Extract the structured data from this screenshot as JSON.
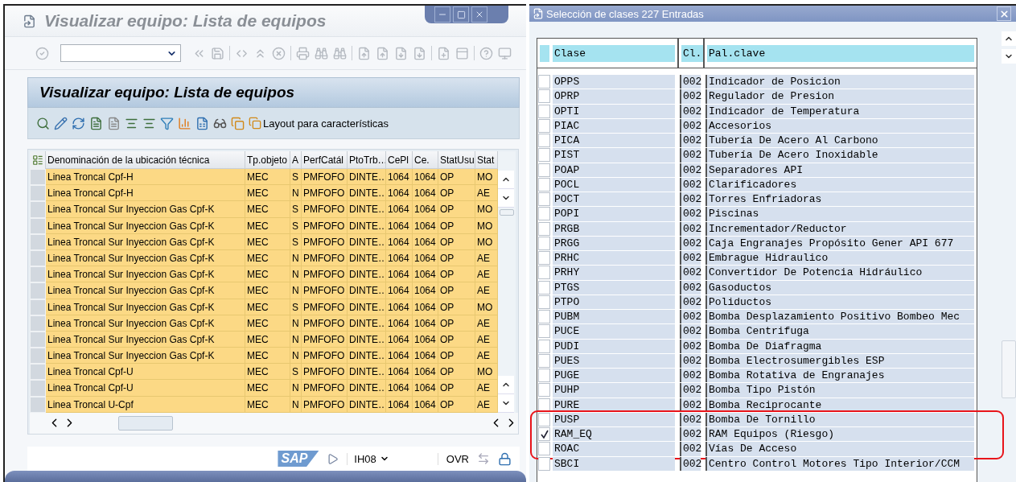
{
  "main_window": {
    "title": "Visualizar equipo: Lista de equipos",
    "header_title": "Visualizar equipo: Lista de equipos",
    "layout_button": "Layout para características"
  },
  "equipment_table": {
    "columns": [
      "Denominación de la ubicación técnica",
      "Tp.objeto",
      "A",
      "PerfCatál",
      "PtoTrb…",
      "CePl",
      "Ce.",
      "StatUsu",
      "Stat"
    ],
    "rows": [
      {
        "cells": [
          "Linea Troncal Cpf-H",
          "MEC",
          "S",
          "PMFOFO",
          "DINTE…",
          "1064",
          "1064",
          "OP",
          "MO"
        ]
      },
      {
        "cells": [
          "Linea Troncal Cpf-H",
          "MEC",
          "N",
          "PMFOFO",
          "DINTE…",
          "1064",
          "1064",
          "OP",
          "AE"
        ]
      },
      {
        "cells": [
          "Linea Troncal Sur Inyeccion Gas Cpf-K",
          "MEC",
          "S",
          "PMFOFO",
          "DINTE…",
          "1064",
          "1064",
          "OP",
          "MO"
        ]
      },
      {
        "cells": [
          "Linea Troncal Sur Inyeccion Gas Cpf-K",
          "MEC",
          "S",
          "PMFOFO",
          "DINTE…",
          "1064",
          "1064",
          "OP",
          "MO"
        ]
      },
      {
        "cells": [
          "Linea Troncal Sur Inyeccion Gas Cpf-K",
          "MEC",
          "S",
          "PMFOFO",
          "DINTE…",
          "1064",
          "1064",
          "OP",
          "MO"
        ]
      },
      {
        "cells": [
          "Linea Troncal Sur Inyeccion Gas Cpf-K",
          "MEC",
          "N",
          "PMFOFO",
          "DINTE…",
          "1064",
          "1064",
          "OP",
          "AE"
        ]
      },
      {
        "cells": [
          "Linea Troncal Sur Inyeccion Gas Cpf-K",
          "MEC",
          "N",
          "PMFOFO",
          "DINTE…",
          "1064",
          "1064",
          "OP",
          "AE"
        ]
      },
      {
        "cells": [
          "Linea Troncal Sur Inyeccion Gas Cpf-K",
          "MEC",
          "N",
          "PMFOFO",
          "DINTE…",
          "1064",
          "1064",
          "OP",
          "AE"
        ]
      },
      {
        "cells": [
          "Linea Troncal Sur Inyeccion Gas Cpf-K",
          "MEC",
          "S",
          "PMFOFO",
          "DINTE…",
          "1064",
          "1064",
          "OP",
          "MO"
        ]
      },
      {
        "cells": [
          "Linea Troncal Sur Inyeccion Gas Cpf-K",
          "MEC",
          "N",
          "PMFOFO",
          "DINTE…",
          "1064",
          "1064",
          "OP",
          "AE"
        ]
      },
      {
        "cells": [
          "Linea Troncal Sur Inyeccion Gas Cpf-K",
          "MEC",
          "N",
          "PMFOFO",
          "DINTE…",
          "1064",
          "1064",
          "OP",
          "AE"
        ]
      },
      {
        "cells": [
          "Linea Troncal Sur Inyeccion Gas Cpf-K",
          "MEC",
          "N",
          "PMFOFO",
          "DINTE…",
          "1064",
          "1064",
          "OP",
          "AE"
        ]
      },
      {
        "cells": [
          "Linea Troncal Cpf-U",
          "MEC",
          "S",
          "PMFOFO",
          "DINTE…",
          "1064",
          "1064",
          "OP",
          "MO"
        ]
      },
      {
        "cells": [
          "Linea Troncal Cpf-U",
          "MEC",
          "N",
          "PMFOFO",
          "DINTE…",
          "1064",
          "1064",
          "OP",
          "AE"
        ]
      },
      {
        "cells": [
          "Linea Troncal U-Cpf",
          "MEC",
          "N",
          "PMFOFO",
          "DINTE…",
          "1064",
          "1064",
          "OP",
          "AE"
        ]
      }
    ]
  },
  "status_bar": {
    "logo": "SAP",
    "transaction": "IH08",
    "mode": "OVR"
  },
  "dialog": {
    "title": "Selección de clases 227 Entradas",
    "columns": [
      "Clase",
      "Cl.",
      "Pal.clave"
    ],
    "row_groups": [
      {
        "highlighted": false,
        "rows": [
          {
            "clase": "OPPS",
            "cl": "002",
            "keyword": "Indicador de Posicion",
            "checked": false
          },
          {
            "clase": "OPRP",
            "cl": "002",
            "keyword": "Regulador de Presion",
            "checked": false
          },
          {
            "clase": "OPTI",
            "cl": "002",
            "keyword": "Indicador de Temperatura",
            "checked": false
          },
          {
            "clase": "PIAC",
            "cl": "002",
            "keyword": "Accesorios",
            "checked": false
          },
          {
            "clase": "PICA",
            "cl": "002",
            "keyword": "Tubería De Acero Al Carbono",
            "checked": false
          },
          {
            "clase": "PIST",
            "cl": "002",
            "keyword": "Tubería De Acero Inoxidable",
            "checked": false
          },
          {
            "clase": "POAP",
            "cl": "002",
            "keyword": "Separadores API",
            "checked": false
          },
          {
            "clase": "POCL",
            "cl": "002",
            "keyword": "Clarificadores",
            "checked": false
          },
          {
            "clase": "POCT",
            "cl": "002",
            "keyword": "Torres Enfriadoras",
            "checked": false
          },
          {
            "clase": "POPI",
            "cl": "002",
            "keyword": "Piscinas",
            "checked": false
          },
          {
            "clase": "PRGB",
            "cl": "002",
            "keyword": "Incrementador/Reductor",
            "checked": false
          },
          {
            "clase": "PRGG",
            "cl": "002",
            "keyword": "Caja Engranajes Propósito Gener  API 677",
            "checked": false
          },
          {
            "clase": "PRHC",
            "cl": "002",
            "keyword": "Embrague Hidraulico",
            "checked": false
          },
          {
            "clase": "PRHY",
            "cl": "002",
            "keyword": "Convertidor De Potencia Hidráulico",
            "checked": false
          },
          {
            "clase": "PTGS",
            "cl": "002",
            "keyword": "Gasoductos",
            "checked": false
          },
          {
            "clase": "PTPO",
            "cl": "002",
            "keyword": "Poliductos",
            "checked": false
          },
          {
            "clase": "PUBM",
            "cl": "002",
            "keyword": "Bomba Desplazamiento Positivo Bombeo Mec",
            "checked": false
          },
          {
            "clase": "PUCE",
            "cl": "002",
            "keyword": "Bomba Centrifuga",
            "checked": false
          },
          {
            "clase": "PUDI",
            "cl": "002",
            "keyword": "Bomba De Diafragma",
            "checked": false
          },
          {
            "clase": "PUES",
            "cl": "002",
            "keyword": "Bomba Electrosumergibles ESP",
            "checked": false
          },
          {
            "clase": "PUGE",
            "cl": "002",
            "keyword": "Bomba Rotativa de Engranajes",
            "checked": false
          },
          {
            "clase": "PUHP",
            "cl": "002",
            "keyword": "Bomba Tipo Pistón",
            "checked": false
          },
          {
            "clase": "PURE",
            "cl": "002",
            "keyword": "Bomba Reciprocante",
            "checked": false
          }
        ]
      },
      {
        "highlighted": true,
        "rows": [
          {
            "clase": "PUSP",
            "cl": "002",
            "keyword": "Bomba De Tornillo",
            "checked": false
          },
          {
            "clase": "RAM_EQ",
            "cl": "002",
            "keyword": "RAM Equipos (Riesgo)",
            "checked": true
          },
          {
            "clase": "ROAC",
            "cl": "002",
            "keyword": "Vías De Acceso",
            "checked": false
          }
        ]
      },
      {
        "highlighted": false,
        "rows": [
          {
            "clase": "SBCI",
            "cl": "002",
            "keyword": "Centro Control Motores Tipo Interior/CCM",
            "checked": false
          }
        ]
      }
    ]
  }
}
